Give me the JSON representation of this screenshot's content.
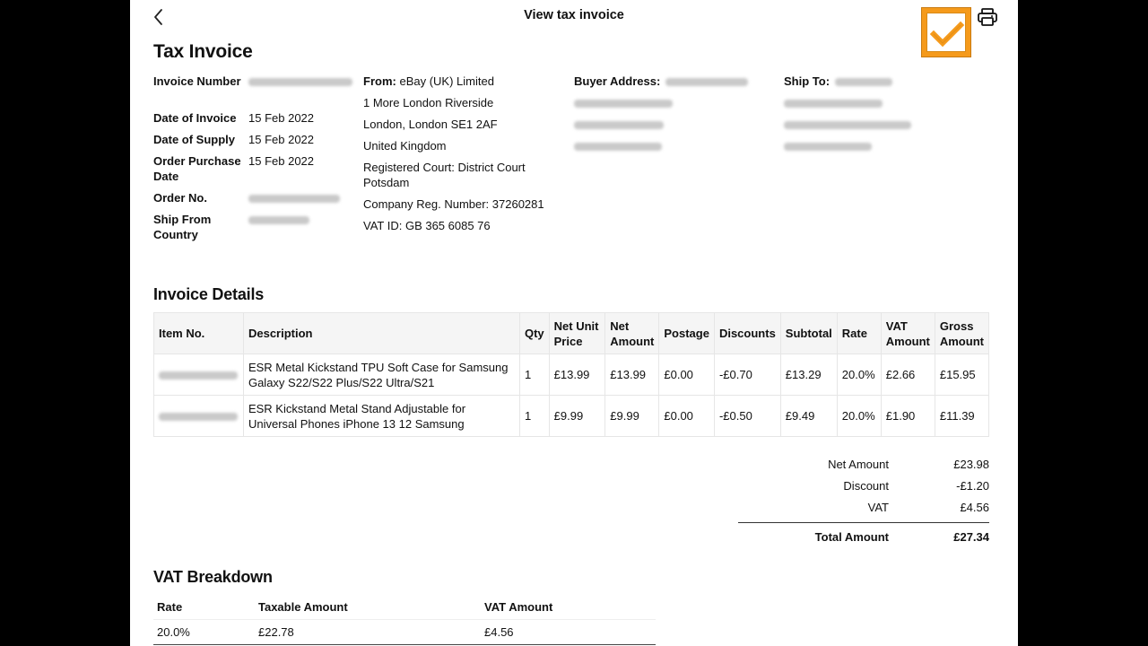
{
  "header": {
    "title": "View tax invoice",
    "back_icon": "chevron-left-icon",
    "checkbox_icon": "checkbox-checked-icon",
    "print_icon": "printer-icon",
    "accent_color": "#f59a1b"
  },
  "invoice": {
    "title": "Tax Invoice",
    "fields": [
      {
        "label": "Invoice Number",
        "value": "",
        "blurred": true
      },
      {
        "label": "Date of Invoice",
        "value": "15 Feb 2022",
        "blurred": false
      },
      {
        "label": "Date of Supply",
        "value": "15 Feb 2022",
        "blurred": false
      },
      {
        "label": "Order Purchase Date",
        "value": "15 Feb 2022",
        "blurred": false
      },
      {
        "label": "Order No.",
        "value": "",
        "blurred": true
      },
      {
        "label": "Ship From Country",
        "value": "",
        "blurred": true
      }
    ],
    "from": {
      "label": "From:",
      "name": "eBay (UK) Limited",
      "lines": [
        "1 More London Riverside",
        "London, London SE1 2AF",
        "United Kingdom",
        "Registered Court: District Court Potsdam",
        "Company Reg. Number: 37260281",
        "VAT ID: GB 365 6085 76"
      ]
    },
    "buyer": {
      "label": "Buyer Address:",
      "blurred": true
    },
    "ship_to": {
      "label": "Ship To:",
      "blurred": true
    }
  },
  "details": {
    "title": "Invoice Details",
    "columns": [
      "Item No.",
      "Description",
      "Qty",
      "Net Unit Price",
      "Net Amount",
      "Postage",
      "Discounts",
      "Subtotal",
      "Rate",
      "VAT Amount",
      "Gross Amount"
    ],
    "rows": [
      {
        "item_no": "",
        "description": "ESR Metal Kickstand TPU Soft Case for Samsung Galaxy S22/S22 Plus/S22 Ultra/S21",
        "qty": "1",
        "net_unit_price": "£13.99",
        "net_amount": "£13.99",
        "postage": "£0.00",
        "discounts": "-£0.70",
        "subtotal": "£13.29",
        "rate": "20.0%",
        "vat_amount": "£2.66",
        "gross_amount": "£15.95"
      },
      {
        "item_no": "",
        "description": "ESR Kickstand Metal Stand Adjustable for Universal Phones iPhone 13 12 Samsung",
        "qty": "1",
        "net_unit_price": "£9.99",
        "net_amount": "£9.99",
        "postage": "£0.00",
        "discounts": "-£0.50",
        "subtotal": "£9.49",
        "rate": "20.0%",
        "vat_amount": "£1.90",
        "gross_amount": "£11.39"
      }
    ]
  },
  "totals": {
    "net_amount_label": "Net Amount",
    "net_amount": "£23.98",
    "discount_label": "Discount",
    "discount": "-£1.20",
    "vat_label": "VAT",
    "vat": "£4.56",
    "total_label": "Total Amount",
    "total": "£27.34"
  },
  "vat_breakdown": {
    "title": "VAT Breakdown",
    "columns": [
      "Rate",
      "Taxable Amount",
      "VAT Amount"
    ],
    "rows": [
      {
        "rate": "20.0%",
        "taxable_amount": "£22.78",
        "vat_amount": "£4.56"
      }
    ]
  }
}
